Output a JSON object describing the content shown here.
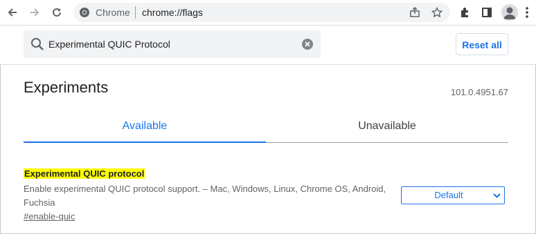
{
  "browser": {
    "site_label": "Chrome",
    "url": "chrome://flags",
    "icons": [
      "back-icon",
      "forward-icon",
      "reload-icon",
      "share-icon",
      "bookmark-star-icon",
      "extensions-icon",
      "side-panel-icon",
      "profile-icon",
      "menu-icon"
    ]
  },
  "search": {
    "value": "Experimental QUIC Protocol"
  },
  "header": {
    "reset_label": "Reset all"
  },
  "page": {
    "title": "Experiments",
    "version": "101.0.4951.67"
  },
  "tabs": [
    {
      "label": "Available",
      "active": true
    },
    {
      "label": "Unavailable",
      "active": false
    }
  ],
  "flag": {
    "title": "Experimental QUIC protocol",
    "description": "Enable experimental QUIC protocol support. – Mac, Windows, Linux, Chrome OS, Android, Fuchsia",
    "link": "#enable-quic",
    "selected_option": "Default"
  },
  "colors": {
    "accent": "#1a73e8",
    "highlight": "#ffff00"
  }
}
